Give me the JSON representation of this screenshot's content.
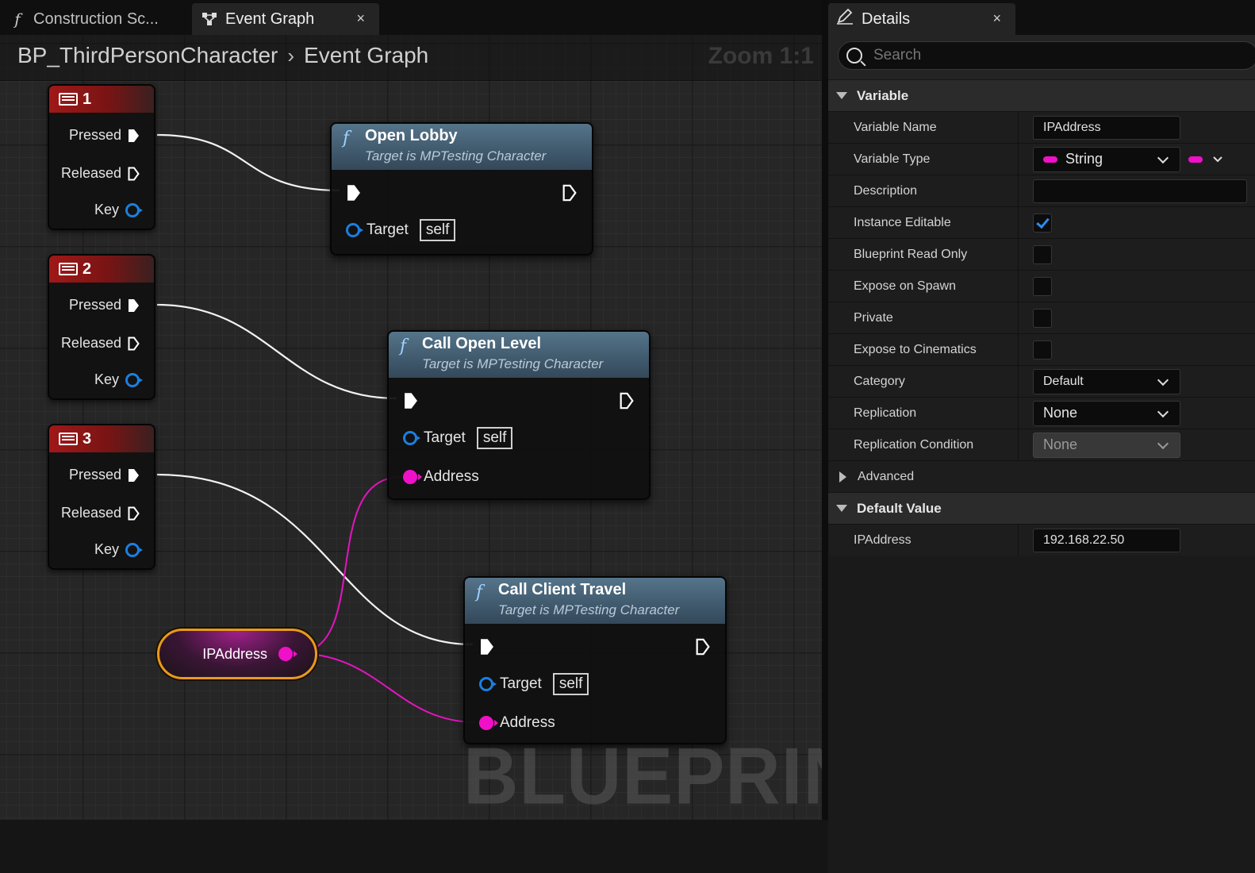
{
  "tabs": {
    "construction_script": "Construction Sc...",
    "event_graph": "Event Graph",
    "close_glyph": "×"
  },
  "graph": {
    "breadcrumb_root": "BP_ThirdPersonCharacter",
    "breadcrumb_sep": "›",
    "breadcrumb_current": "Event Graph",
    "zoom": "Zoom 1:1",
    "watermark": "BLUEPRINT"
  },
  "key_nodes": [
    {
      "key": "1",
      "pressed": "Pressed",
      "released": "Released",
      "key_label": "Key"
    },
    {
      "key": "2",
      "pressed": "Pressed",
      "released": "Released",
      "key_label": "Key"
    },
    {
      "key": "3",
      "pressed": "Pressed",
      "released": "Released",
      "key_label": "Key"
    }
  ],
  "func_nodes": [
    {
      "title": "Open Lobby",
      "subtitle": "Target is MPTesting Character",
      "target_label": "Target",
      "target_value": "self"
    },
    {
      "title": "Call Open Level",
      "subtitle": "Target is MPTesting Character",
      "target_label": "Target",
      "target_value": "self",
      "address_label": "Address"
    },
    {
      "title": "Call Client Travel",
      "subtitle": "Target is MPTesting Character",
      "target_label": "Target",
      "target_value": "self",
      "address_label": "Address"
    }
  ],
  "variable_node": {
    "label": "IPAddress"
  },
  "details": {
    "tab_title": "Details",
    "search_placeholder": "Search",
    "variable_category": "Variable",
    "props": {
      "variable_name": {
        "label": "Variable Name",
        "value": "IPAddress"
      },
      "variable_type": {
        "label": "Variable Type",
        "value": "String"
      },
      "description": {
        "label": "Description",
        "value": ""
      },
      "instance_editable": {
        "label": "Instance Editable",
        "checked": true
      },
      "blueprint_read_only": {
        "label": "Blueprint Read Only",
        "checked": false
      },
      "expose_on_spawn": {
        "label": "Expose on Spawn",
        "checked": false
      },
      "private": {
        "label": "Private",
        "checked": false
      },
      "expose_to_cinematics": {
        "label": "Expose to Cinematics",
        "checked": false
      },
      "category": {
        "label": "Category",
        "value": "Default"
      },
      "replication": {
        "label": "Replication",
        "value": "None"
      },
      "replication_condition": {
        "label": "Replication Condition",
        "value": "None"
      }
    },
    "advanced": "Advanced",
    "default_value_category": "Default Value",
    "default_value": {
      "label": "IPAddress",
      "value": "192.168.22.50"
    }
  },
  "colors": {
    "exec_wire": "#ffffff",
    "string_pin": "#f010c8",
    "object_pin": "#1b7fe0",
    "key_header": "#a01818",
    "func_header": "#4a6478",
    "var_outline": "#e89a1a",
    "checkbox_check": "#2a8cf0"
  }
}
